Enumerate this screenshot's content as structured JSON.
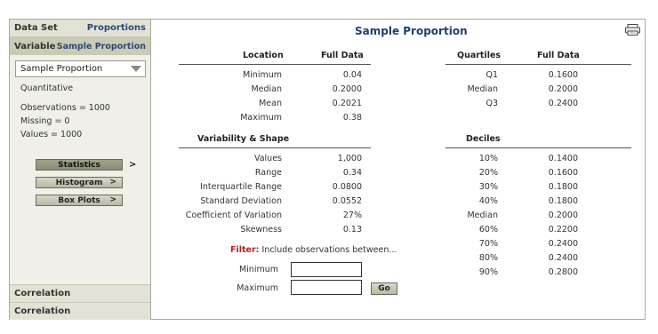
{
  "sidebar": {
    "dataset_label": "Data Set",
    "dataset_value": "Proportions",
    "variable_label": "Variable",
    "variable_value": "Sample Proportion",
    "select_value": "Sample Proportion",
    "type": "Quantitative",
    "observations": "Observations = 1000",
    "missing": "Missing = 0",
    "values": "Values = 1000",
    "buttons": [
      {
        "label": "Statistics",
        "suffix": ">"
      },
      {
        "label": "Histogram",
        "chev": ">"
      },
      {
        "label": "Box Plots",
        "chev": ">"
      }
    ],
    "bottom": [
      "Correlation",
      "Correlation"
    ]
  },
  "main": {
    "title": "Sample Proportion",
    "location": {
      "header": "Location",
      "col": "Full Data",
      "rows": [
        {
          "label": "Minimum",
          "value": "0.04"
        },
        {
          "label": "Median",
          "value": "0.2000"
        },
        {
          "label": "Mean",
          "value": "0.2021"
        },
        {
          "label": "Maximum",
          "value": "0.38"
        }
      ]
    },
    "variability": {
      "header": "Variability & Shape",
      "rows": [
        {
          "label": "Values",
          "value": "1,000"
        },
        {
          "label": "Range",
          "value": "0.34"
        },
        {
          "label": "Interquartile Range",
          "value": "0.0800"
        },
        {
          "label": "Standard Deviation",
          "value": "0.0552"
        },
        {
          "label": "Coefficient of Variation",
          "value": "27%"
        },
        {
          "label": "Skewness",
          "value": "0.13"
        }
      ]
    },
    "quartiles": {
      "header": "Quartiles",
      "col": "Full Data",
      "rows": [
        {
          "label": "Q1",
          "value": "0.1600"
        },
        {
          "label": "Median",
          "value": "0.2000"
        },
        {
          "label": "Q3",
          "value": "0.2400"
        }
      ]
    },
    "deciles": {
      "header": "Deciles",
      "rows": [
        {
          "label": "10%",
          "value": "0.1400"
        },
        {
          "label": "20%",
          "value": "0.1600"
        },
        {
          "label": "30%",
          "value": "0.1800"
        },
        {
          "label": "40%",
          "value": "0.1800"
        },
        {
          "label": "Median",
          "value": "0.2000"
        },
        {
          "label": "60%",
          "value": "0.2200"
        },
        {
          "label": "70%",
          "value": "0.2400"
        },
        {
          "label": "80%",
          "value": "0.2400"
        },
        {
          "label": "90%",
          "value": "0.2800"
        }
      ]
    },
    "filter": {
      "label": "Filter:",
      "text": "Include observations between...",
      "min_label": "Minimum",
      "max_label": "Maximum",
      "min_value": "",
      "max_value": "",
      "go": "Go"
    }
  }
}
